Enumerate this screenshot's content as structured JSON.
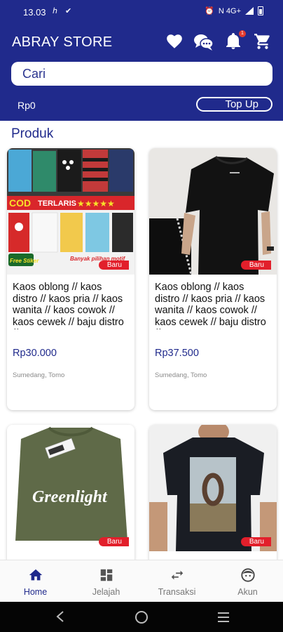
{
  "status_bar": {
    "time": "13.03",
    "left_icons": "ℎ ✔",
    "network": "N 4G+"
  },
  "header": {
    "title": "ABRAY STORE",
    "cart_badge": "1",
    "search": {
      "placeholder": "Cari",
      "value": ""
    },
    "balance": "Rp0",
    "topup_label": "Top Up",
    "accent": "#202a8c"
  },
  "section_title": "Produk",
  "products": [
    {
      "name": "Kaos oblong // kaos distro // kaos pria // kaos wanita // kaos cowok // kaos cewek // baju distro //",
      "price": "Rp30.000",
      "location": "Sumedang, Tomo",
      "badge": "Baru",
      "image_text": {
        "cod": "COD",
        "terlaris": "TERLARIS",
        "free": "Free Stiker",
        "banyak": "Banyak pilihan motif"
      }
    },
    {
      "name": "Kaos oblong // kaos distro // kaos pria // kaos wanita // kaos cowok // kaos cewek // baju distro //",
      "price": "Rp37.500",
      "location": "Sumedang, Tomo",
      "badge": "Baru"
    },
    {
      "badge": "Baru",
      "image_text": {
        "brand": "Greenlight"
      }
    },
    {
      "badge": "Baru"
    }
  ],
  "bottom_nav": [
    {
      "label": "Home",
      "icon": "home-icon",
      "active": true
    },
    {
      "label": "Jelajah",
      "icon": "grid-icon",
      "active": false
    },
    {
      "label": "Transaksi",
      "icon": "swap-icon",
      "active": false
    },
    {
      "label": "Akun",
      "icon": "face-icon",
      "active": false
    }
  ]
}
